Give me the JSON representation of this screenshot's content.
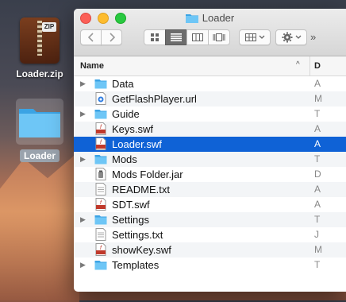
{
  "desktop": {
    "zip_icon": {
      "label": "Loader.zip",
      "tag": "ZIP"
    },
    "folder_icon": {
      "label": "Loader"
    }
  },
  "window": {
    "title": "Loader",
    "column_name": "Name",
    "column_next": "D",
    "more_glyph": "»"
  },
  "files": [
    {
      "name": "Data",
      "type": "folder",
      "trail": "A"
    },
    {
      "name": "GetFlashPlayer.url",
      "type": "url",
      "trail": "M"
    },
    {
      "name": "Guide",
      "type": "folder",
      "trail": "T"
    },
    {
      "name": "Keys.swf",
      "type": "swf",
      "trail": "A"
    },
    {
      "name": "Loader.swf",
      "type": "swf",
      "trail": "A"
    },
    {
      "name": "Mods",
      "type": "folder",
      "trail": "T"
    },
    {
      "name": "Mods Folder.jar",
      "type": "jar",
      "trail": "D"
    },
    {
      "name": "README.txt",
      "type": "txt",
      "trail": "A"
    },
    {
      "name": "SDT.swf",
      "type": "swf",
      "trail": "A"
    },
    {
      "name": "Settings",
      "type": "folder",
      "trail": "T"
    },
    {
      "name": "Settings.txt",
      "type": "txt",
      "trail": "J"
    },
    {
      "name": "showKey.swf",
      "type": "swf",
      "trail": "M"
    },
    {
      "name": "Templates",
      "type": "folder",
      "trail": "T"
    }
  ],
  "selected_index": 4,
  "colors": {
    "selection": "#0f62d6",
    "folder": "#4fb0e8"
  }
}
